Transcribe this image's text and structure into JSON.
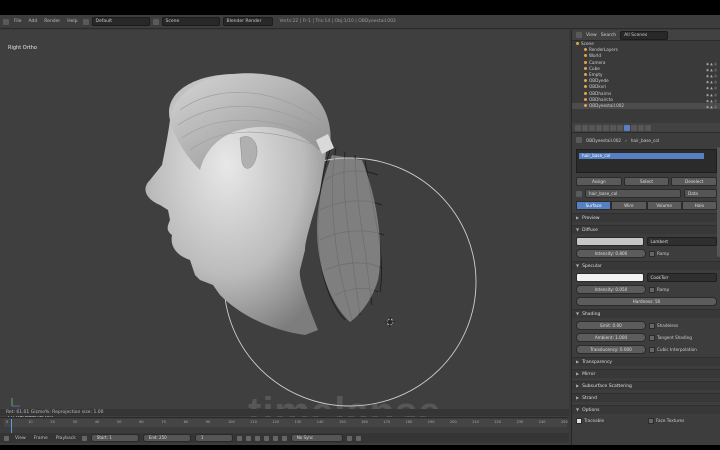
{
  "topbar": {
    "menus": [
      "File",
      "Add",
      "Render",
      "Help"
    ],
    "layout": "Default",
    "scene": "Scene",
    "engine": "Blender Render",
    "stats": "Verts:22 | Fr:1 | Tris:14 | Obj:1/10 | OBDyeestail.002"
  },
  "viewport": {
    "view_label": "Right Ortho",
    "object_label": "(1) OBDyeestail.002",
    "status_text": "Ret: 61.01 Gizmo%: Reprojection size: 1.00",
    "watermark": "timelapse"
  },
  "timeline": {
    "ticks": [
      "0",
      "10",
      "20",
      "30",
      "40",
      "50",
      "60",
      "70",
      "80",
      "90",
      "100",
      "110",
      "120",
      "130",
      "140",
      "150",
      "160",
      "170",
      "180",
      "190",
      "200",
      "210",
      "220",
      "230",
      "240",
      "250"
    ],
    "menus": [
      "View",
      "Frame",
      "Playback"
    ],
    "start": "Start: 1",
    "end": "End: 250",
    "current": "1",
    "sync": "No Sync"
  },
  "outliner": {
    "header": [
      "View",
      "Search",
      "All Scenes"
    ],
    "items": [
      "Scene",
      "RenderLayers",
      "World",
      "Camera",
      "Cube",
      "Empty",
      "OBDyede",
      "OBDkvri",
      "OBDhairns",
      "OBDhaircto",
      "OBDyeestail.002"
    ]
  },
  "properties": {
    "breadcrumb": [
      "OBDyeestail.002",
      "hair_base_col"
    ],
    "material_selected": "hair_base_col",
    "buttons": [
      "Assign",
      "Select",
      "Deselect"
    ],
    "datablock": "hair_base_col",
    "data_field": "Data",
    "type_tabs": [
      "Surface",
      "Wire",
      "Volume",
      "Halo"
    ],
    "sections": {
      "preview": "Preview",
      "diffuse": "Diffuse",
      "specular": "Specular",
      "shading": "Shading",
      "transparency": "Transparency",
      "mirror": "Mirror",
      "sss": "Subsurface Scattering",
      "strand": "Strand",
      "options": "Options"
    },
    "diffuse": {
      "shader": "Lambert",
      "intensity": "Intensity: 0.800",
      "ramp": "Ramp",
      "color": "#c7c7c7"
    },
    "specular": {
      "shader": "CookTorr",
      "intensity": "Intensity: 0.050",
      "ramp": "Ramp",
      "hardness": "Hardness: 50",
      "color": "#f2f2f2"
    },
    "shading": {
      "emit": "Emit: 0.00",
      "ambient": "Ambient: 1.000",
      "translucency": "Translucency: 0.000",
      "shadeless": "Shadeless",
      "tangent": "Tangent Shading",
      "cubic": "Cubic Interpolation"
    },
    "options": {
      "traceable": "Traceable",
      "face_textures": "Face Textures"
    }
  }
}
